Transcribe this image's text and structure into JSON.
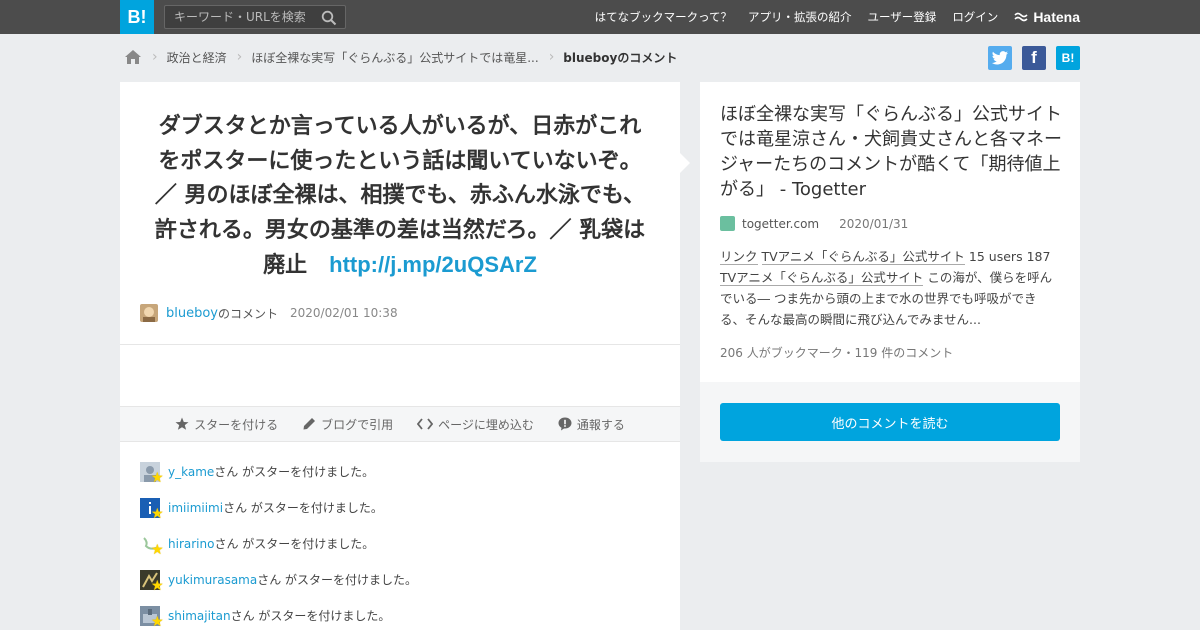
{
  "header": {
    "logo": "B!",
    "search_placeholder": "キーワード・URLを検索",
    "nav": [
      "はてなブックマークって？",
      "アプリ・拡張の紹介",
      "ユーザー登録",
      "ログイン"
    ],
    "hatena": "Hatena"
  },
  "breadcrumb": {
    "items": [
      "政治と経済",
      "ほぼ全裸な実写「ぐらんぶる」公式サイトでは竜星...",
      "blueboyのコメント"
    ]
  },
  "comment": {
    "text": "ダブスタとか言っている人がいるが、日赤がこれをポスターに使ったという話は聞いていないぞ。／ 男のほぼ全裸は、相撲でも、赤ふん水泳でも、許される。男女の基準の差は当然だろ。／ 乳袋は廃止",
    "link": "http://j.mp/2uQSArZ",
    "user": "blueboy",
    "suffix": "のコメント",
    "date": "2020/02/01 10:38"
  },
  "actions": {
    "star": "スターを付ける",
    "blog": "ブログで引用",
    "embed": "ページに埋め込む",
    "report": "通報する"
  },
  "stars": {
    "suffix": "さん がスターを付けました。",
    "users": [
      "y_kame",
      "imiimiimi",
      "hirarino",
      "yukimurasama",
      "shimajitan"
    ]
  },
  "entry": {
    "title": "ほぼ全裸な実写「ぐらんぶる」公式サイトでは竜星涼さん・犬飼貴丈さんと各マネージャーたちのコメントが酷くて「期待値上がる」 - Togetter",
    "domain": "togetter.com",
    "date": "2020/01/31",
    "desc_link1": "リンク",
    "desc_link2": "TVアニメ「ぐらんぶる」公式サイト",
    "desc_users": "15 users",
    "desc_num": "187",
    "desc_link3": "TVアニメ「ぐらんぶる」公式サイト",
    "desc_rest": "この海が、僕らを呼んでいる― つま先から頭の上まで水の世界でも呼吸ができる、そんな最高の瞬間に飛び込んでみません...",
    "stats": "206 人がブックマーク・119 件のコメント",
    "more_button": "他のコメントを読む"
  },
  "colors": {
    "accent": "#00a4de",
    "link": "#1b9bd1",
    "header_bg": "#4c4c4c",
    "star": "#ffd700"
  }
}
